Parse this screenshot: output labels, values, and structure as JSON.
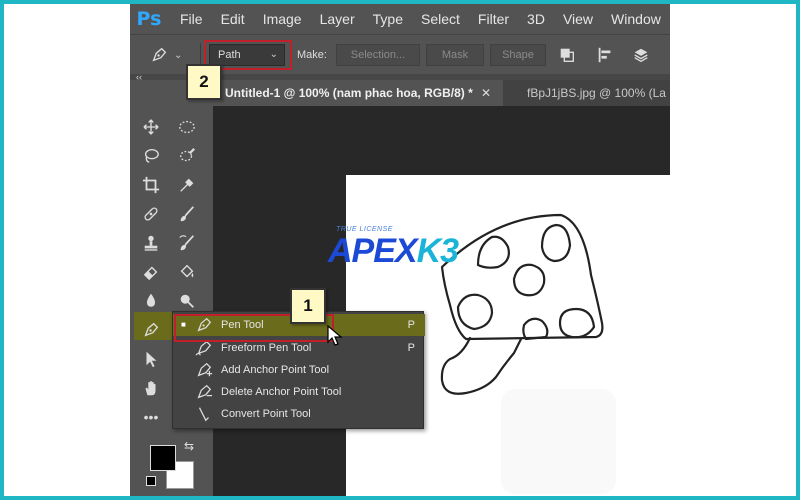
{
  "app": {
    "logo": "Ps",
    "menu": [
      "File",
      "Edit",
      "Image",
      "Layer",
      "Type",
      "Select",
      "Filter",
      "3D",
      "View",
      "Window"
    ]
  },
  "options_bar": {
    "tool_icon": "pen-icon",
    "mode_value": "Path",
    "make_label": "Make:",
    "selection_button": "Selection...",
    "mask_button": "Mask",
    "shape_button": "Shape"
  },
  "tabs": [
    {
      "label": "Untitled-1 @ 100% (nam phac hoa, RGB/8) *",
      "close": "✕"
    },
    {
      "label": "fBpJ1jBS.jpg @ 100% (La"
    }
  ],
  "toolbar": {
    "collapse": "‹‹",
    "tools": [
      "move-icon",
      "marquee-icon",
      "lasso-icon",
      "quick-select-icon",
      "crop-icon",
      "eyedropper-icon",
      "healing-icon",
      "brush-icon",
      "stamp-icon",
      "history-brush-icon",
      "eraser-icon",
      "paint-bucket-icon",
      "blur-icon",
      "dodge-icon",
      "pen-icon",
      "path-select-icon",
      "hand-icon",
      "more-icon"
    ],
    "more_label": "•••"
  },
  "flyout": {
    "items": [
      {
        "label": "Pen Tool",
        "shortcut": "P",
        "active": true,
        "icon": "pen-icon"
      },
      {
        "label": "Freeform Pen Tool",
        "shortcut": "P",
        "active": false,
        "icon": "freeform-pen-icon"
      },
      {
        "label": "Add Anchor Point Tool",
        "shortcut": "",
        "active": false,
        "icon": "add-anchor-icon"
      },
      {
        "label": "Delete Anchor Point Tool",
        "shortcut": "",
        "active": false,
        "icon": "delete-anchor-icon"
      },
      {
        "label": "Convert Point Tool",
        "shortcut": "",
        "active": false,
        "icon": "convert-point-icon"
      }
    ]
  },
  "callouts": {
    "one": "1",
    "two": "2"
  },
  "watermark": {
    "small": "TRUE LICENSE",
    "part1": "APEX",
    "part2": "K3"
  },
  "colors": {
    "frame": "#1fb7c4",
    "ui_bg": "#535353",
    "highlight": "#6b6b1c",
    "annotation_red": "#c0202a",
    "callout_bg": "#fff9c6"
  }
}
